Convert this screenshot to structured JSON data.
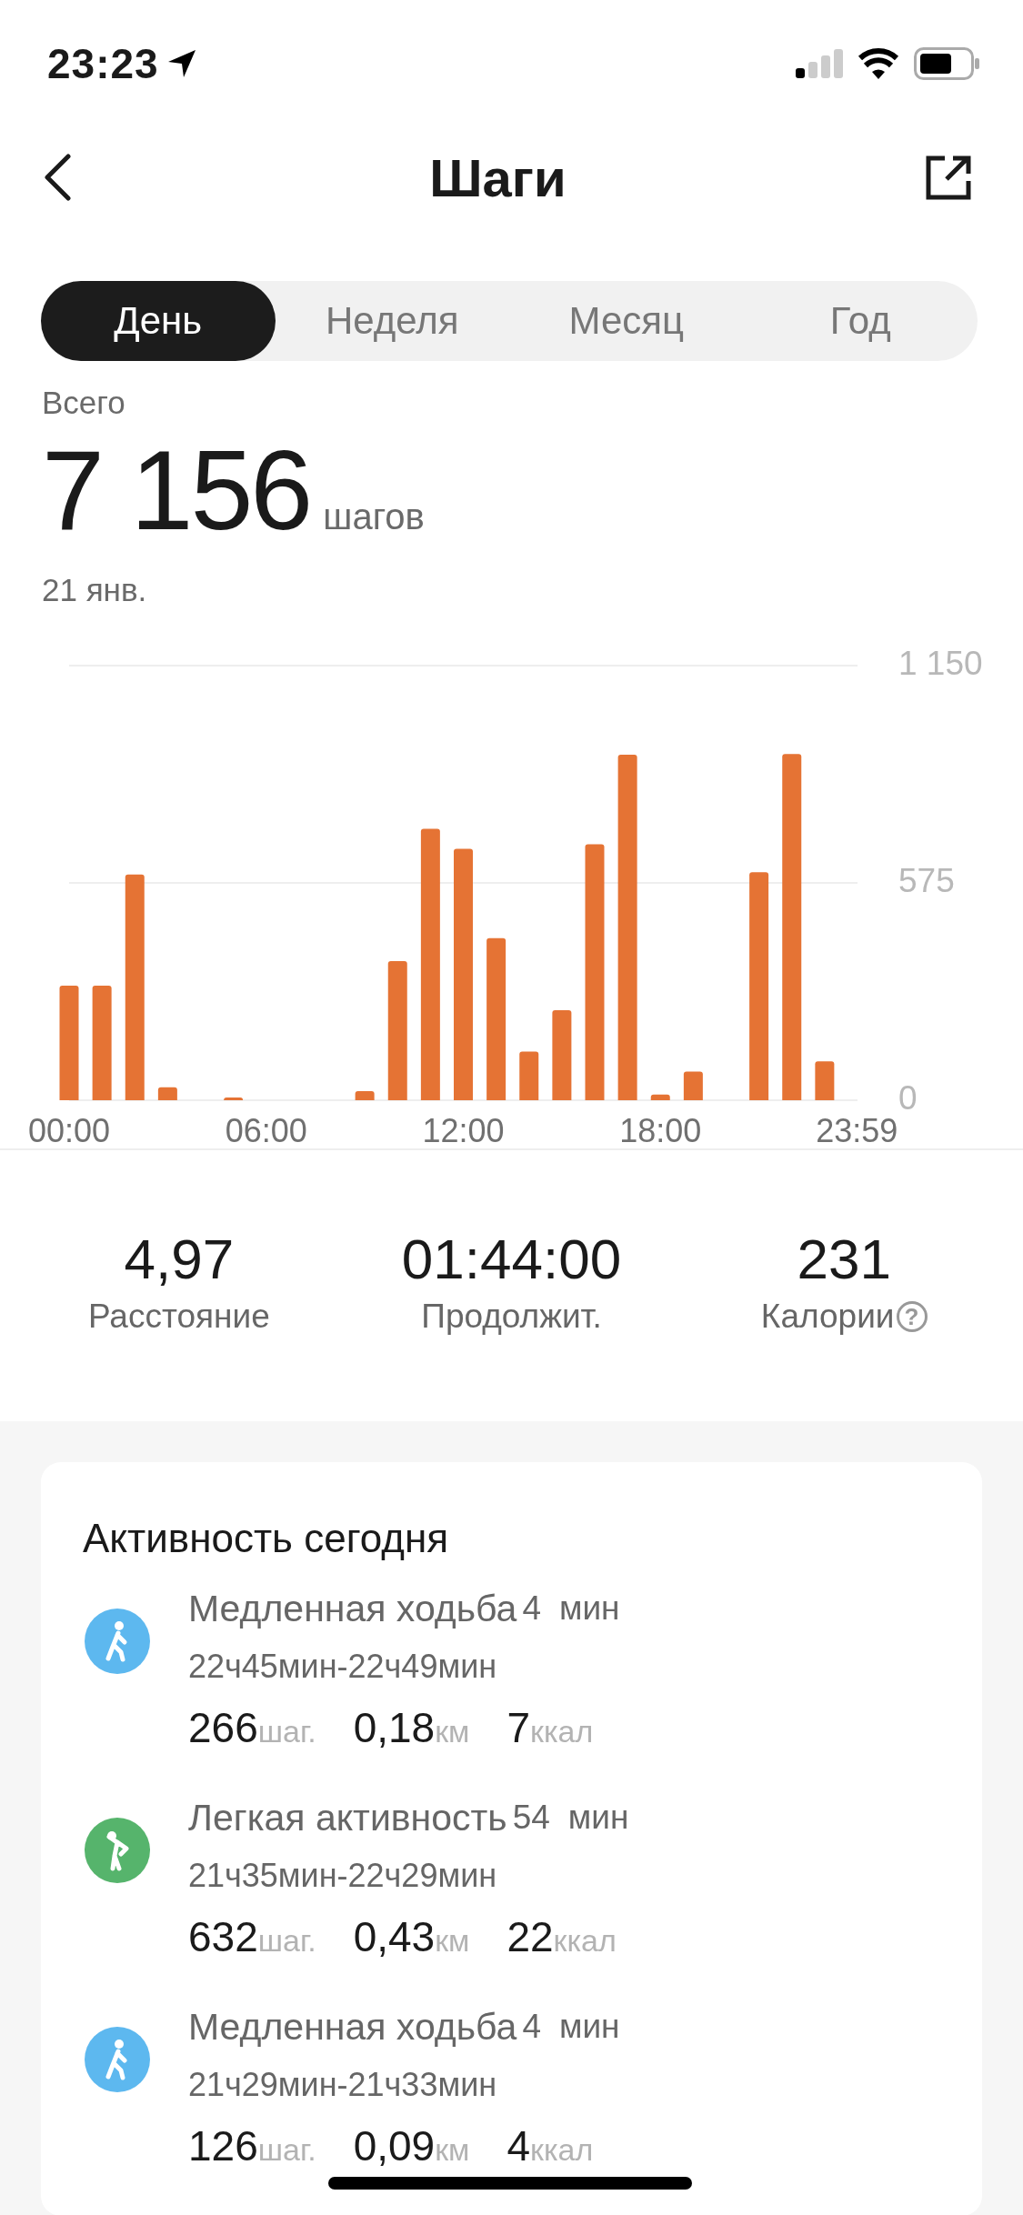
{
  "status_bar": {
    "time": "23:23"
  },
  "nav": {
    "title": "Шаги"
  },
  "tabs": [
    {
      "label": "День",
      "selected": true
    },
    {
      "label": "Неделя",
      "selected": false
    },
    {
      "label": "Месяц",
      "selected": false
    },
    {
      "label": "Год",
      "selected": false
    }
  ],
  "summary": {
    "label": "Всего",
    "total": "7 156",
    "unit": "шагов",
    "date": "21 янв."
  },
  "chart": {
    "chart_data": {
      "type": "bar",
      "x": [
        0,
        1,
        2,
        3,
        4,
        5,
        6,
        7,
        8,
        9,
        10,
        11,
        12,
        13,
        14,
        15,
        16,
        17,
        18,
        19,
        20,
        21,
        22,
        23
      ],
      "xlim": [
        0,
        24
      ],
      "series": [
        {
          "color": "#e57334",
          "values": [
            303,
            303,
            597,
            34,
            0,
            7,
            0,
            0,
            0,
            24,
            368,
            718,
            665,
            429,
            129,
            238,
            677,
            914,
            15,
            76,
            0,
            603,
            916,
            103
          ]
        }
      ],
      "ylim": [
        0,
        1150
      ],
      "yticks": [
        {
          "value": 1150,
          "label": "1 150"
        },
        {
          "value": 575,
          "label": "575"
        },
        {
          "value": 0,
          "label": "0"
        }
      ],
      "xticks": [
        {
          "value": 0,
          "label": "00:00"
        },
        {
          "value": 6,
          "label": "06:00"
        },
        {
          "value": 12,
          "label": "12:00"
        },
        {
          "value": 18,
          "label": "18:00"
        },
        {
          "value": 23.98,
          "label": "23:59"
        }
      ]
    }
  },
  "stats": [
    {
      "value": "4,97",
      "label": "Расстояние"
    },
    {
      "value": "01:44:00",
      "label": "Продолжит."
    },
    {
      "value": "231",
      "label": "Калории",
      "help_icon": "?"
    }
  ],
  "activity": {
    "title": "Активность сегодня",
    "items": [
      {
        "kind": "walk",
        "name": "Медленная ходьба",
        "duration": "4",
        "duration_unit": "мин",
        "time": "22ч45мин-22ч49мин",
        "metrics": [
          {
            "value": "266",
            "unit": "шаг."
          },
          {
            "value": "0,18",
            "unit": "км"
          },
          {
            "value": "7",
            "unit": "ккал"
          }
        ]
      },
      {
        "kind": "light",
        "name": "Легкая активность",
        "duration": "54",
        "duration_unit": "мин",
        "time": "21ч35мин-22ч29мин",
        "metrics": [
          {
            "value": "632",
            "unit": "шаг."
          },
          {
            "value": "0,43",
            "unit": "км"
          },
          {
            "value": "22",
            "unit": "ккал"
          }
        ]
      },
      {
        "kind": "walk",
        "name": "Медленная ходьба",
        "duration": "4",
        "duration_unit": "мин",
        "time": "21ч29мин-21ч33мин",
        "metrics": [
          {
            "value": "126",
            "unit": "шаг."
          },
          {
            "value": "0,09",
            "unit": "км"
          },
          {
            "value": "4",
            "unit": "ккал"
          }
        ]
      }
    ]
  }
}
